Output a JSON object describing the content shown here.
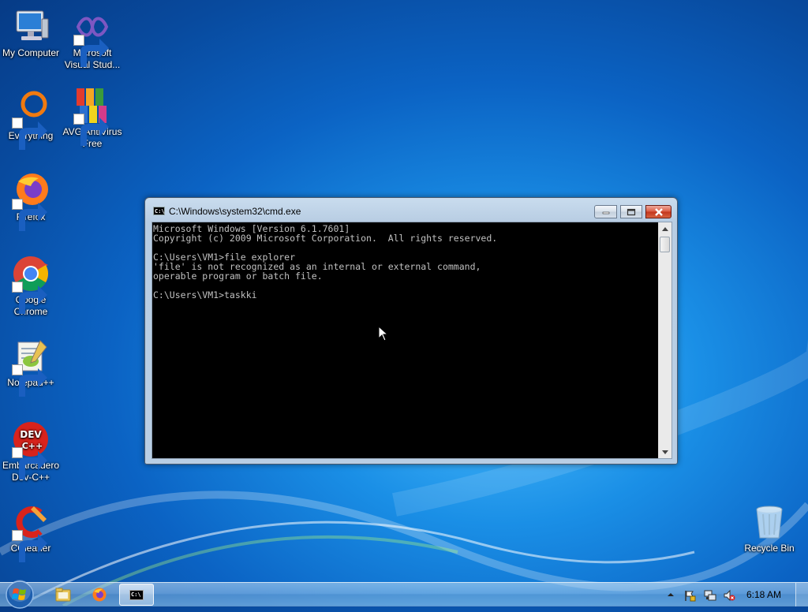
{
  "desktop": {
    "icons": [
      {
        "label": "My Computer",
        "icon": "computer-icon"
      },
      {
        "label": "Microsoft\nVisual Stud...",
        "icon": "visual-studio-icon"
      },
      {
        "label": "Everything",
        "icon": "everything-icon"
      },
      {
        "label": "AVG AntiVirus\nFree",
        "icon": "avg-icon"
      },
      {
        "label": "Firefox",
        "icon": "firefox-icon"
      },
      {
        "label": "Google\nChrome",
        "icon": "chrome-icon"
      },
      {
        "label": "Notepad++",
        "icon": "notepadpp-icon"
      },
      {
        "label": "Embarcadero\nDev-C++",
        "icon": "devcpp-icon"
      },
      {
        "label": "CCleaner",
        "icon": "ccleaner-icon"
      },
      {
        "label": "Recycle Bin",
        "icon": "recycle-bin-icon"
      }
    ]
  },
  "cmd_window": {
    "title": "C:\\Windows\\system32\\cmd.exe",
    "title_icon_text": "C:\\",
    "console_text": "Microsoft Windows [Version 6.1.7601]\nCopyright (c) 2009 Microsoft Corporation.  All rights reserved.\n\nC:\\Users\\VM1>file explorer\n'file' is not recognized as an internal or external command,\noperable program or batch file.\n\nC:\\Users\\VM1>taskki"
  },
  "taskbar": {
    "tasks": [
      "windows-explorer",
      "firefox",
      "command-prompt"
    ],
    "active_task": "command-prompt",
    "cmd_task_icon_text": "C:\\",
    "clock": "6:18 AM"
  },
  "colors": {
    "console_bg": "#000000",
    "console_fg": "#c0c0c0",
    "close_button": "#c7402b",
    "desktop_bg": "#0b63c4"
  }
}
